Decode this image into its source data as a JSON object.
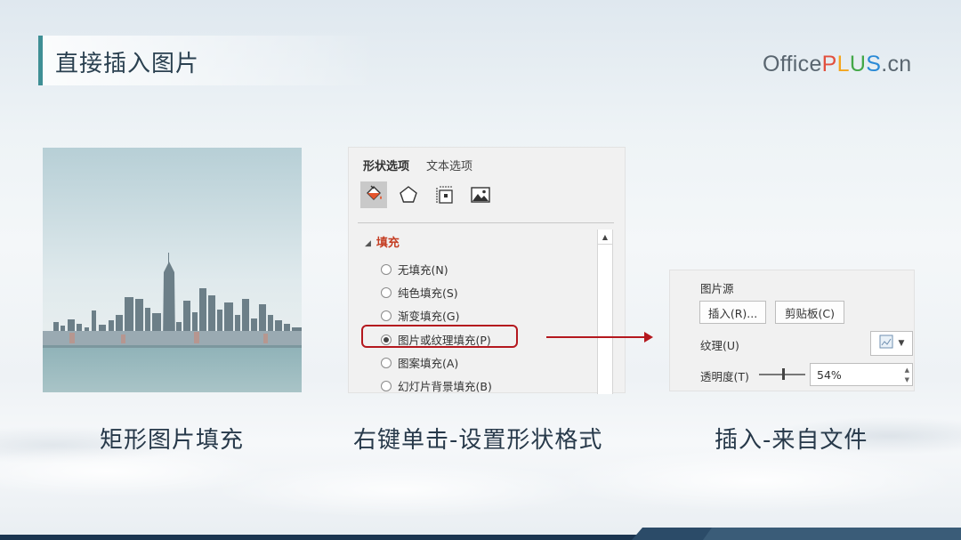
{
  "slide": {
    "title": "直接插入图片",
    "logo": {
      "office": "Office",
      "p": "P",
      "l": "L",
      "u": "U",
      "s": "S",
      "cn": ".cn"
    },
    "captions": {
      "left": "矩形图片填充",
      "middle": "右键单击-设置形状格式",
      "right": "插入-来自文件"
    }
  },
  "format_panel": {
    "tabs": [
      "形状选项",
      "文本选项"
    ],
    "icons": [
      "fill-line-icon",
      "pentagon-effects-icon",
      "size-properties-icon",
      "picture-icon"
    ],
    "section": "填充",
    "options": [
      {
        "label": "无填充(N)",
        "selected": false
      },
      {
        "label": "纯色填充(S)",
        "selected": false
      },
      {
        "label": "渐变填充(G)",
        "selected": false
      },
      {
        "label": "图片或纹理填充(P)",
        "selected": true
      },
      {
        "label": "图案填充(A)",
        "selected": false
      },
      {
        "label": "幻灯片背景填充(B)",
        "selected": false
      }
    ]
  },
  "picture_source": {
    "header": "图片源",
    "insert_button": "插入(R)...",
    "clipboard_button": "剪贴板(C)",
    "texture_label": "纹理(U)",
    "transparency_label": "透明度(T)",
    "transparency_value": "54%"
  },
  "colors": {
    "accent": "#3f8f95",
    "highlight": "#b4181e",
    "section_red": "#c43d22"
  }
}
